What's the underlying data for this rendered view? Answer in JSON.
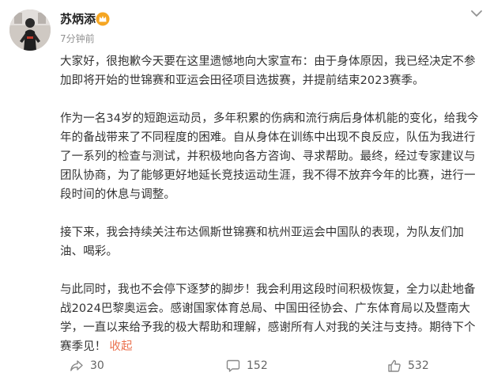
{
  "post": {
    "author": "苏炳添",
    "time": "7分钟前",
    "paragraphs": [
      "大家好，很抱歉今天要在这里遗憾地向大家宣布：由于身体原因，我已经决定不参加即将开始的世锦赛和亚运会田径项目选拔赛，并提前结束2023赛季。",
      "作为一名34岁的短跑运动员，多年积累的伤病和流行病后身体机能的变化，给我今年的备战带来了不同程度的困难。自从身体在训练中出现不良反应，队伍为我进行了一系列的检查与测试，并积极地向各方咨询、寻求帮助。最终，经过专家建议与团队协商，为了能够更好地延长竞技运动生涯，我不得不放弃今年的比赛，进行一段时间的休息与调整。",
      "接下来，我会持续关注布达佩斯世锦赛和杭州亚运会中国队的表现，为队友们加油、喝彩。"
    ],
    "last_paragraph": "与此同时，我也不会停下逐梦的脚步！我会利用这段时间积极恢复，全力以赴地备战2024巴黎奥运会。感谢国家体育总局、中国田径协会、广东体育局以及暨南大学，一直以来给予我的极大帮助和理解，感谢所有人对我的关注与支持。期待下个赛季见！",
    "collapse_label": "收起"
  },
  "actions": {
    "forward_count": "30",
    "comment_count": "152",
    "like_count": "532"
  },
  "icons": {
    "avatar": "avatar-photo",
    "verify": "crown-badge-icon",
    "menu": "chevron-down-icon",
    "forward": "share-icon",
    "comment": "comment-icon",
    "like": "thumbs-up-icon"
  },
  "colors": {
    "link": "#eb7350",
    "badge": "#f5a623",
    "muted": "#939393"
  }
}
